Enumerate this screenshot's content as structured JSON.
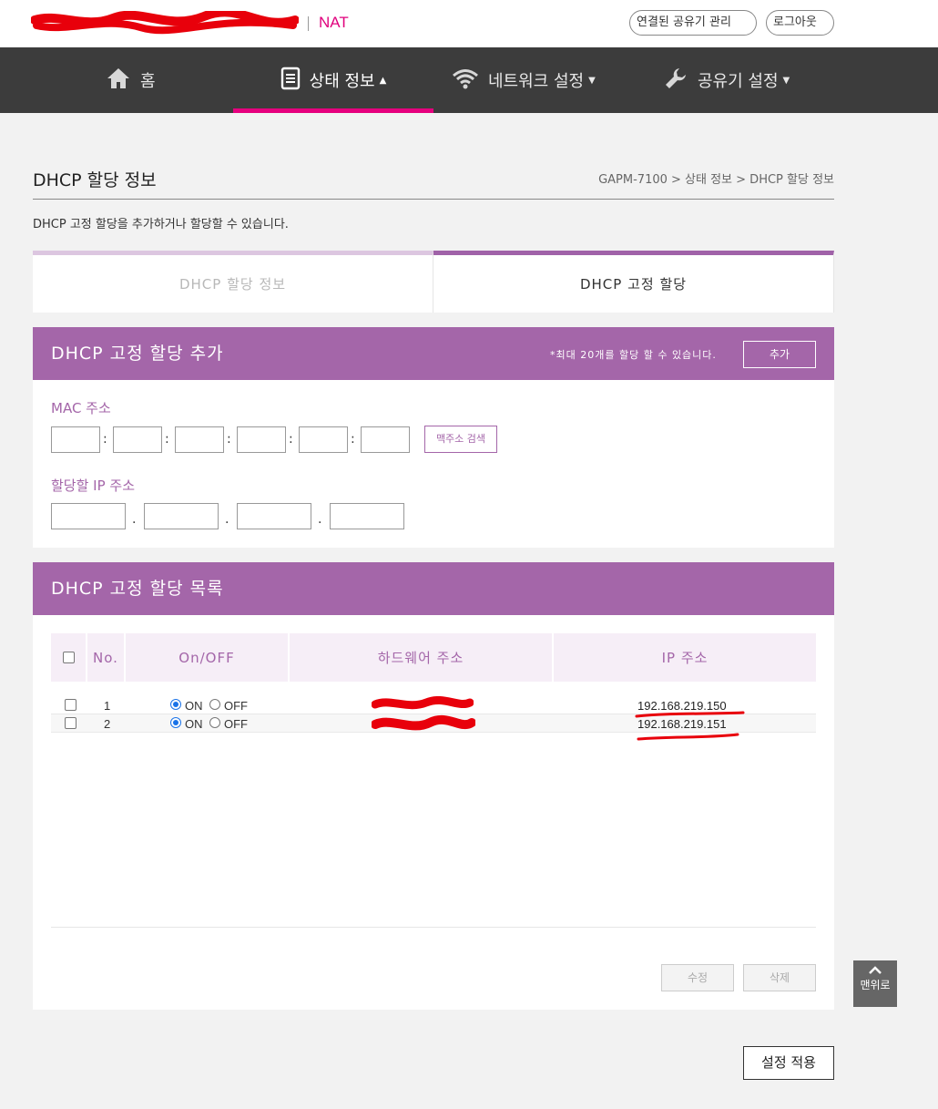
{
  "header": {
    "brand_suffix": "NAT",
    "manage_label": "연결된 공유기 관리",
    "logout_label": "로그아웃"
  },
  "nav": {
    "items": [
      {
        "label": "홈",
        "icon": "home-icon"
      },
      {
        "label": "상태 정보",
        "icon": "document-icon",
        "caret": "▲",
        "active": true
      },
      {
        "label": "네트워크 설정",
        "icon": "wifi-icon",
        "caret": "▼"
      },
      {
        "label": "공유기 설정",
        "icon": "wrench-icon",
        "caret": "▼"
      }
    ]
  },
  "page": {
    "title": "DHCP 할당 정보",
    "breadcrumb": "GAPM-7100 > 상태 정보 > DHCP 할당 정보",
    "description": "DHCP 고정 할당을 추가하거나 할당할 수 있습니다."
  },
  "tabs": [
    {
      "label": "DHCP 할당 정보",
      "active": false
    },
    {
      "label": "DHCP 고정 할당",
      "active": true
    }
  ],
  "add_panel": {
    "title": "DHCP 고정 할당 추가",
    "max_note": "*최대 20개를 할당 할 수 있습니다.",
    "add_label": "추가",
    "mac_label": "MAC 주소",
    "mac_search_label": "맥주소 검색",
    "ip_label": "할당할 IP 주소",
    "mac_sep": ":",
    "ip_sep": "."
  },
  "list_panel": {
    "title": "DHCP 고정 할당 목록",
    "columns": [
      "No.",
      "On/OFF",
      "하드웨어 주소",
      "IP 주소"
    ],
    "on_label": "ON",
    "off_label": "OFF",
    "rows": [
      {
        "no": "1",
        "enabled": true,
        "ip": "192.168.219.150"
      },
      {
        "no": "2",
        "enabled": true,
        "ip": "192.168.219.151"
      }
    ],
    "edit_label": "수정",
    "delete_label": "삭제"
  },
  "apply_label": "설정 적용",
  "scroll_top_label": "맨위로",
  "colors": {
    "accent": "#a466a9",
    "brand_pink": "#e6007e",
    "nav_bg": "#3c3c3c",
    "annotation_red": "#e8000b"
  }
}
